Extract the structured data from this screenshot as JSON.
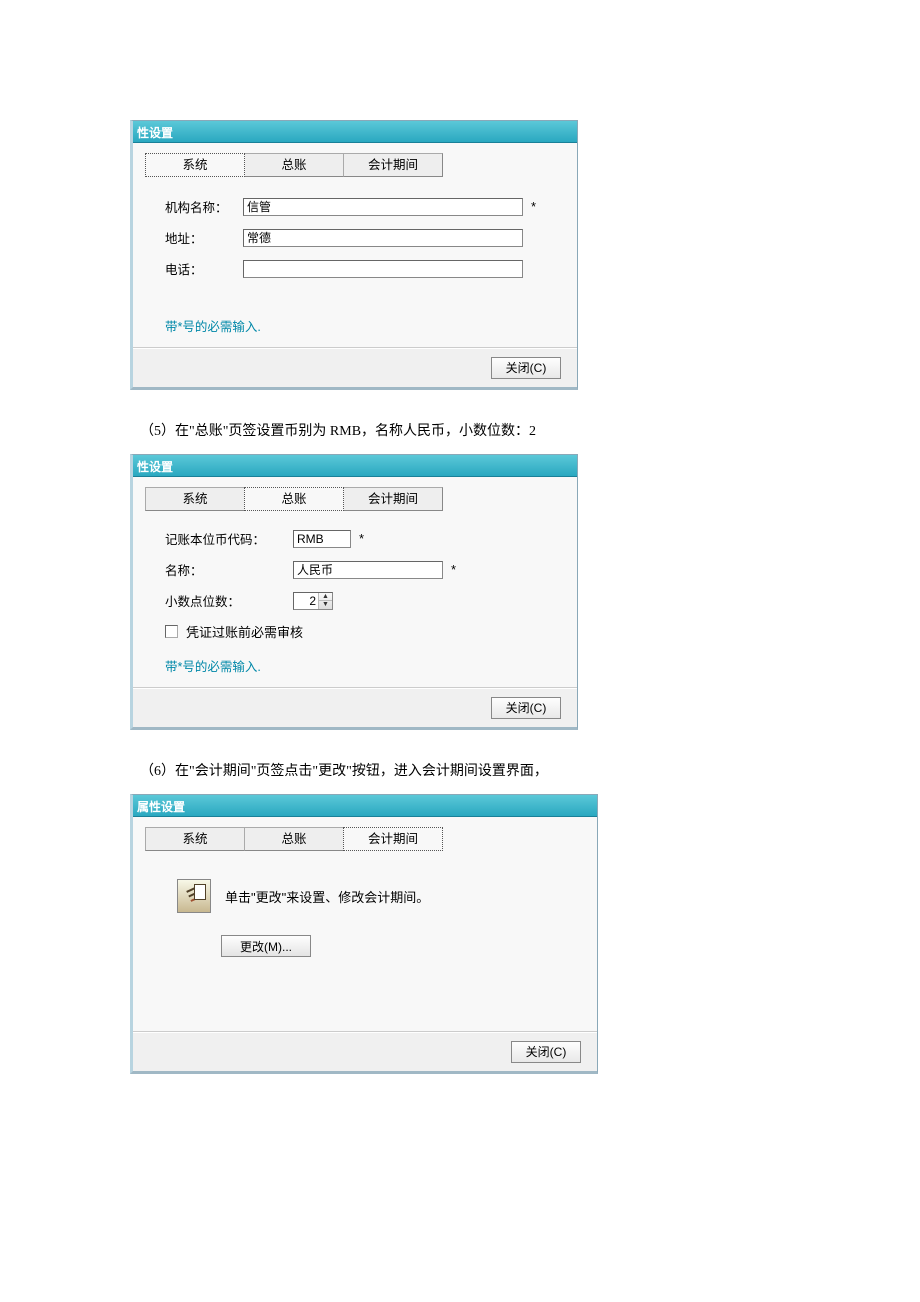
{
  "dialog1": {
    "title": "性设置",
    "tabs": [
      "系统",
      "总账",
      "会计期间"
    ],
    "activeTabIndex": 0,
    "fields": {
      "orgNameLabel": "机构名称：",
      "orgNameValue": "信管",
      "addressLabel": "地址：",
      "addressValue": "常德",
      "phoneLabel": "电话：",
      "phoneValue": ""
    },
    "requiredMark": "*",
    "hintText": "带*号的必需输入.",
    "closeBtn": "关闭(C)"
  },
  "instr5": "（5）在\"总账\"页签设置币别为 RMB，名称人民币，小数位数：2",
  "dialog2": {
    "title": "性设置",
    "tabs": [
      "系统",
      "总账",
      "会计期间"
    ],
    "activeTabIndex": 1,
    "fields": {
      "currencyCodeLabel": "记账本位币代码：",
      "currencyCodeValue": "RMB",
      "nameLabel": "名称：",
      "nameValue": "人民币",
      "decimalsLabel": "小数点位数：",
      "decimalsValue": "2",
      "auditCheckLabel": "凭证过账前必需审核"
    },
    "requiredMark": "*",
    "hintText": "带*号的必需输入.",
    "closeBtn": "关闭(C)"
  },
  "instr6": "（6）在\"会计期间\"页签点击\"更改\"按钮，进入会计期间设置界面，",
  "dialog3": {
    "title": "属性设置",
    "tabs": [
      "系统",
      "总账",
      "会计期间"
    ],
    "activeTabIndex": 2,
    "noteText": "单击\"更改\"来设置、修改会计期间。",
    "modifyBtn": "更改(M)...",
    "closeBtn": "关闭(C)"
  }
}
